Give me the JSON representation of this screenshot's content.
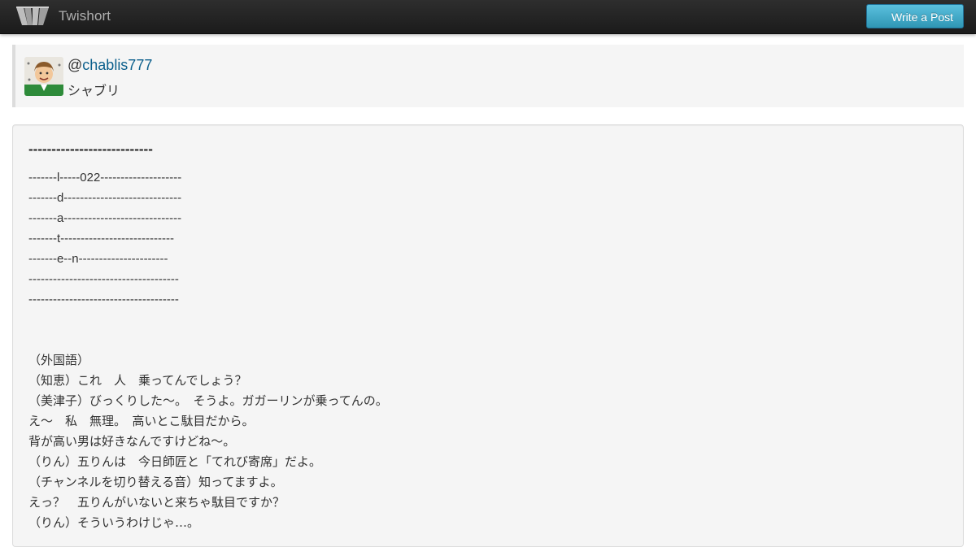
{
  "navbar": {
    "brand_name": "Twishort",
    "logo_icon": "twishort-logo-icon",
    "write_button_label": "Write a Post"
  },
  "profile": {
    "at_sign": "@",
    "username": "chablis777",
    "display_name": "シャブリ",
    "avatar_icon": "user-avatar"
  },
  "post": {
    "title": "---------------------------",
    "lines": [
      "-------l-----022--------------------",
      "-------d-----------------------------",
      "-------a-----------------------------",
      "-------t----------------------------",
      "-------e--n----------------------",
      "-------------------------------------",
      "-------------------------------------",
      "",
      "",
      "（外国語）",
      "（知恵）これ　人　乗ってんでしょう？",
      "（美津子）びっくりした～。　そうよ。ガガーリンが乗ってんの。",
      "え～　私　無理。　高いとこ駄目だから。",
      "背が高い男は好きなんですけどね～。",
      "（りん）五りんは　今日師匠と「てれび寄席」だよ。",
      "（チャンネルを切り替える音）知ってますよ。",
      "えっ？　五りんがいないと来ちゃ駄目ですか？",
      "（りん）そういうわけじゃ…。"
    ]
  },
  "colors": {
    "navbar_bg": "#222222",
    "button_bg": "#49afcd",
    "link": "#0b5f8c",
    "card_bg": "#f5f5f5"
  }
}
